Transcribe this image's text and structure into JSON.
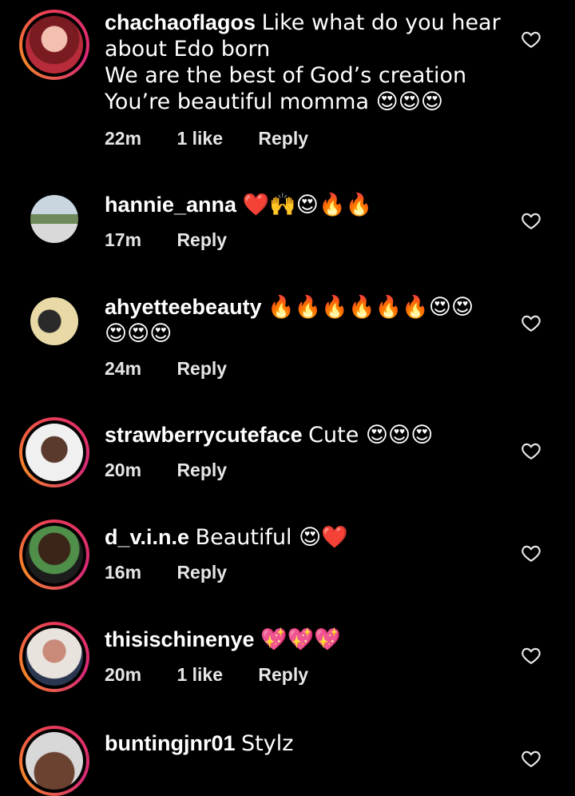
{
  "comments": [
    {
      "username": "chachaoflagos",
      "text": "Like what do you hear\nabout Edo born\nWe are the best of God’s creation\nYou’re beautiful momma 😍😍😍",
      "time": "22m",
      "likes": "1 like",
      "reply": "Reply"
    },
    {
      "username": "hannie_anna",
      "text": "❤️🙌😍🔥🔥",
      "time": "17m",
      "likes": "",
      "reply": "Reply"
    },
    {
      "username": "ahyetteebeauty",
      "text": "🔥🔥🔥🔥🔥🔥😍😍\n😍😍😍",
      "time": "24m",
      "likes": "",
      "reply": "Reply"
    },
    {
      "username": "strawberrycuteface",
      "text": "Cute 😍😍😍",
      "time": "20m",
      "likes": "",
      "reply": "Reply"
    },
    {
      "username": "d_v.i.n.e",
      "text": "Beautiful 😍❤️",
      "time": "16m",
      "likes": "",
      "reply": "Reply"
    },
    {
      "username": "thisischinenye",
      "text": "💖💖💖",
      "time": "20m",
      "likes": "1 like",
      "reply": "Reply"
    },
    {
      "username": "buntingjnr01",
      "text": "Stylz",
      "time": "",
      "likes": "",
      "reply": ""
    }
  ],
  "icons": {
    "like": "heart-outline-icon"
  },
  "colors": {
    "story_ring": "#e8395a",
    "meta_text": "#e6e6e6"
  }
}
